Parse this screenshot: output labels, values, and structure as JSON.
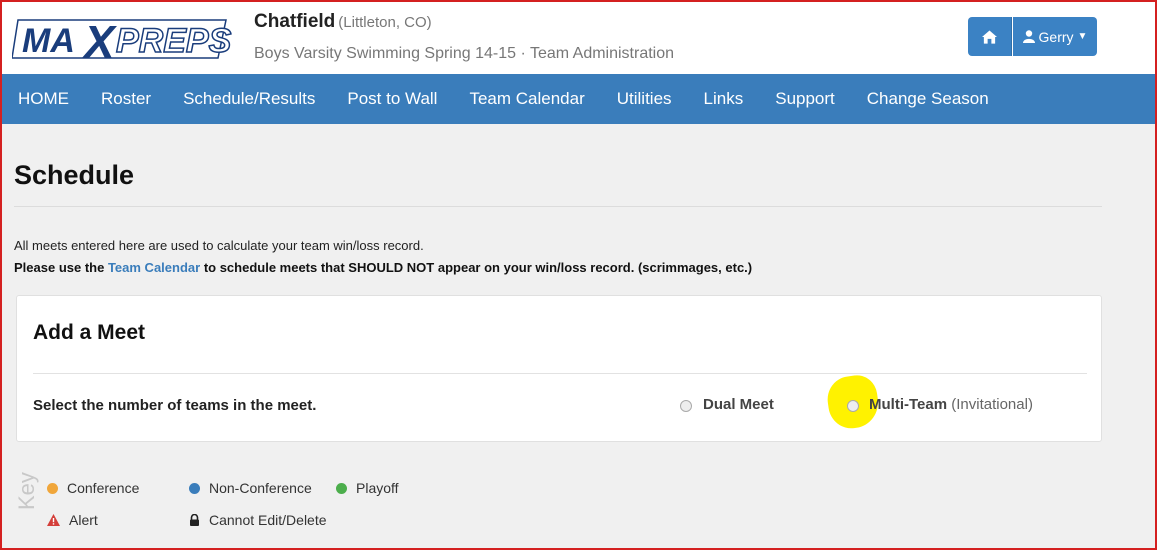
{
  "header": {
    "logo_text": "MAXPREPS",
    "school_name": "Chatfield",
    "school_location": "(Littleton, CO)",
    "team_line": "Boys Varsity Swimming Spring 14-15 · Team Administration",
    "user_label": "Gerry",
    "home_icon": "home-icon",
    "user_icon": "user-icon"
  },
  "nav": {
    "items": [
      "HOME",
      "Roster",
      "Schedule/Results",
      "Post to Wall",
      "Team Calendar",
      "Utilities",
      "Links",
      "Support",
      "Change Season"
    ]
  },
  "page": {
    "title": "Schedule",
    "info_line1": "All meets entered here are used to calculate your team win/loss record.",
    "info_line2_pre": "Please use the ",
    "info_line2_link": "Team Calendar",
    "info_line2_post": " to schedule meets that SHOULD NOT appear on your win/loss record. (scrimmages, etc.)"
  },
  "add_meet": {
    "title": "Add a Meet",
    "prompt": "Select the number of teams in the meet.",
    "option_dual": "Dual Meet",
    "option_multi": "Multi-Team",
    "option_multi_sub": "(Invitational)"
  },
  "key": {
    "label": "Key",
    "conference": "Conference",
    "non_conference": "Non-Conference",
    "playoff": "Playoff",
    "alert": "Alert",
    "cannot_edit": "Cannot Edit/Delete"
  },
  "colors": {
    "nav_blue": "#3a7dbb",
    "conference": "#f0a63a",
    "non_conference": "#3a7dbb",
    "playoff": "#4cae4c",
    "alert": "#d43f3a",
    "highlight": "#fff200"
  }
}
